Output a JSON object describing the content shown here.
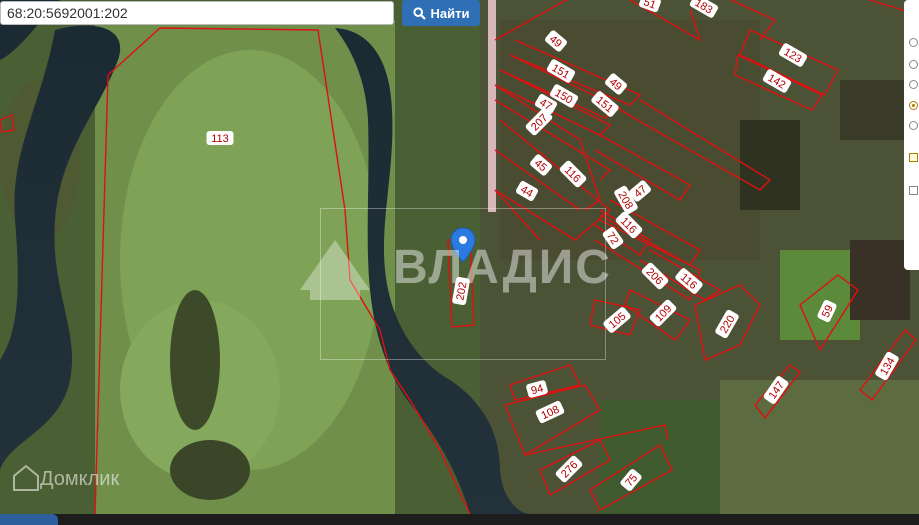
{
  "search": {
    "value": "68:20:5692001:202",
    "button_label": "Найти"
  },
  "watermark": {
    "brand_text": "ВЛАДИС",
    "domclick_text": "Домклик"
  },
  "parcels": [
    {
      "label": "113"
    },
    {
      "label": "202"
    },
    {
      "label": "51"
    },
    {
      "label": "183"
    },
    {
      "label": "49"
    },
    {
      "label": "151"
    },
    {
      "label": "49"
    },
    {
      "label": "123"
    },
    {
      "label": "142"
    },
    {
      "label": "150"
    },
    {
      "label": "151"
    },
    {
      "label": "47"
    },
    {
      "label": "207"
    },
    {
      "label": "45"
    },
    {
      "label": "116"
    },
    {
      "label": "44"
    },
    {
      "label": "208"
    },
    {
      "label": "47"
    },
    {
      "label": "116"
    },
    {
      "label": "72"
    },
    {
      "label": "206"
    },
    {
      "label": "116"
    },
    {
      "label": "109"
    },
    {
      "label": "105"
    },
    {
      "label": "220"
    },
    {
      "label": "59"
    },
    {
      "label": "134"
    },
    {
      "label": "147"
    },
    {
      "label": "94"
    },
    {
      "label": "108"
    },
    {
      "label": "276"
    },
    {
      "label": "75"
    }
  ],
  "colors": {
    "parcel_border": "#e01010",
    "marker": "#2a7ae2",
    "search_button": "#2f6fb5"
  },
  "icons": {
    "search_button_icon": "search-icon",
    "marker": "map-pin-icon"
  },
  "layer_controls": {
    "radios_selected_index": 3,
    "checkbox_checked": true
  }
}
